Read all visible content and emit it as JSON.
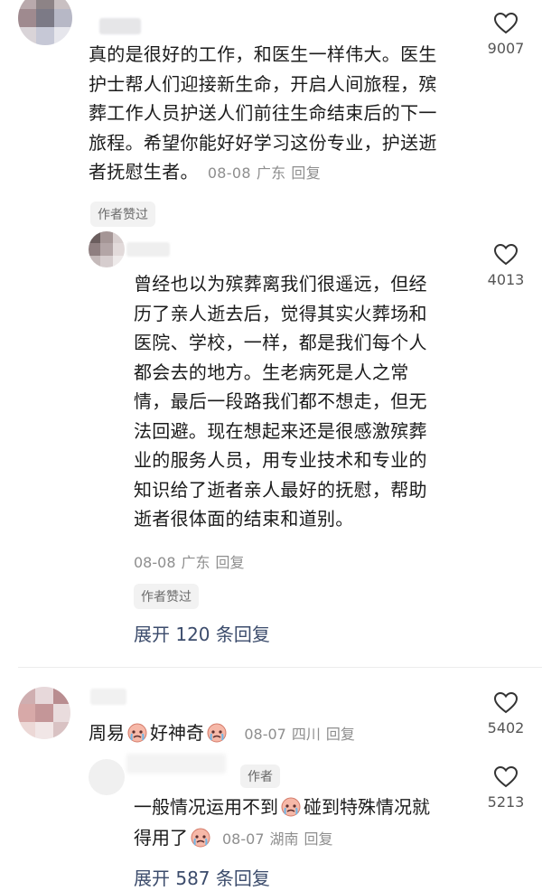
{
  "comments": [
    {
      "lines": [
        "真的是很好的工作，和医生一样伟大。医生",
        "护士帮人们迎接新生命，开启人间旅程，殡",
        "葬工作人员护送人们前往生命结束后的下一",
        "旅程。希望你能好好学习这份专业，护送逝"
      ],
      "last_line": "者抚慰生者。",
      "date": "08-08",
      "location": "广东",
      "reply": "回复",
      "likes": "9007",
      "badge": "作者赞过"
    },
    {
      "lines": [
        "曾经也以为殡葬离我们很遥远，但经",
        "历了亲人逝去后，觉得其实火葬场和",
        "医院、学校，一样，都是我们每个人",
        "都会去的地方。生老病死是人之常",
        "情，最后一段路我们都不想走，但无",
        "法回避。现在想起来还是很感激殡葬",
        "业的服务人员，用专业技术和专业的",
        "知识给了逝者亲人最好的抚慰，帮助",
        "逝者很体面的结束和道别。"
      ],
      "date": "08-08",
      "location": "广东",
      "reply": "回复",
      "likes": "4013",
      "badge": "作者赞过",
      "expand": "展开 120 条回复"
    },
    {
      "text_a": "周易",
      "text_b": "好神奇",
      "date": "08-07",
      "location": "四川",
      "reply": "回复",
      "likes": "5402"
    },
    {
      "author_tag": "作者",
      "line1_a": "一般情况运用不到",
      "line1_b": "碰到特殊情况就",
      "line2_a": "得用了",
      "date": "08-07",
      "location": "湖南",
      "reply": "回复",
      "likes": "5213",
      "expand": "展开 587 条回复"
    }
  ],
  "icons": {
    "like": "heart-outline-icon",
    "emoji": "crying-face-emoji"
  },
  "colors": {
    "expand": "#3c4c6c",
    "meta": "#8e8e8e"
  }
}
